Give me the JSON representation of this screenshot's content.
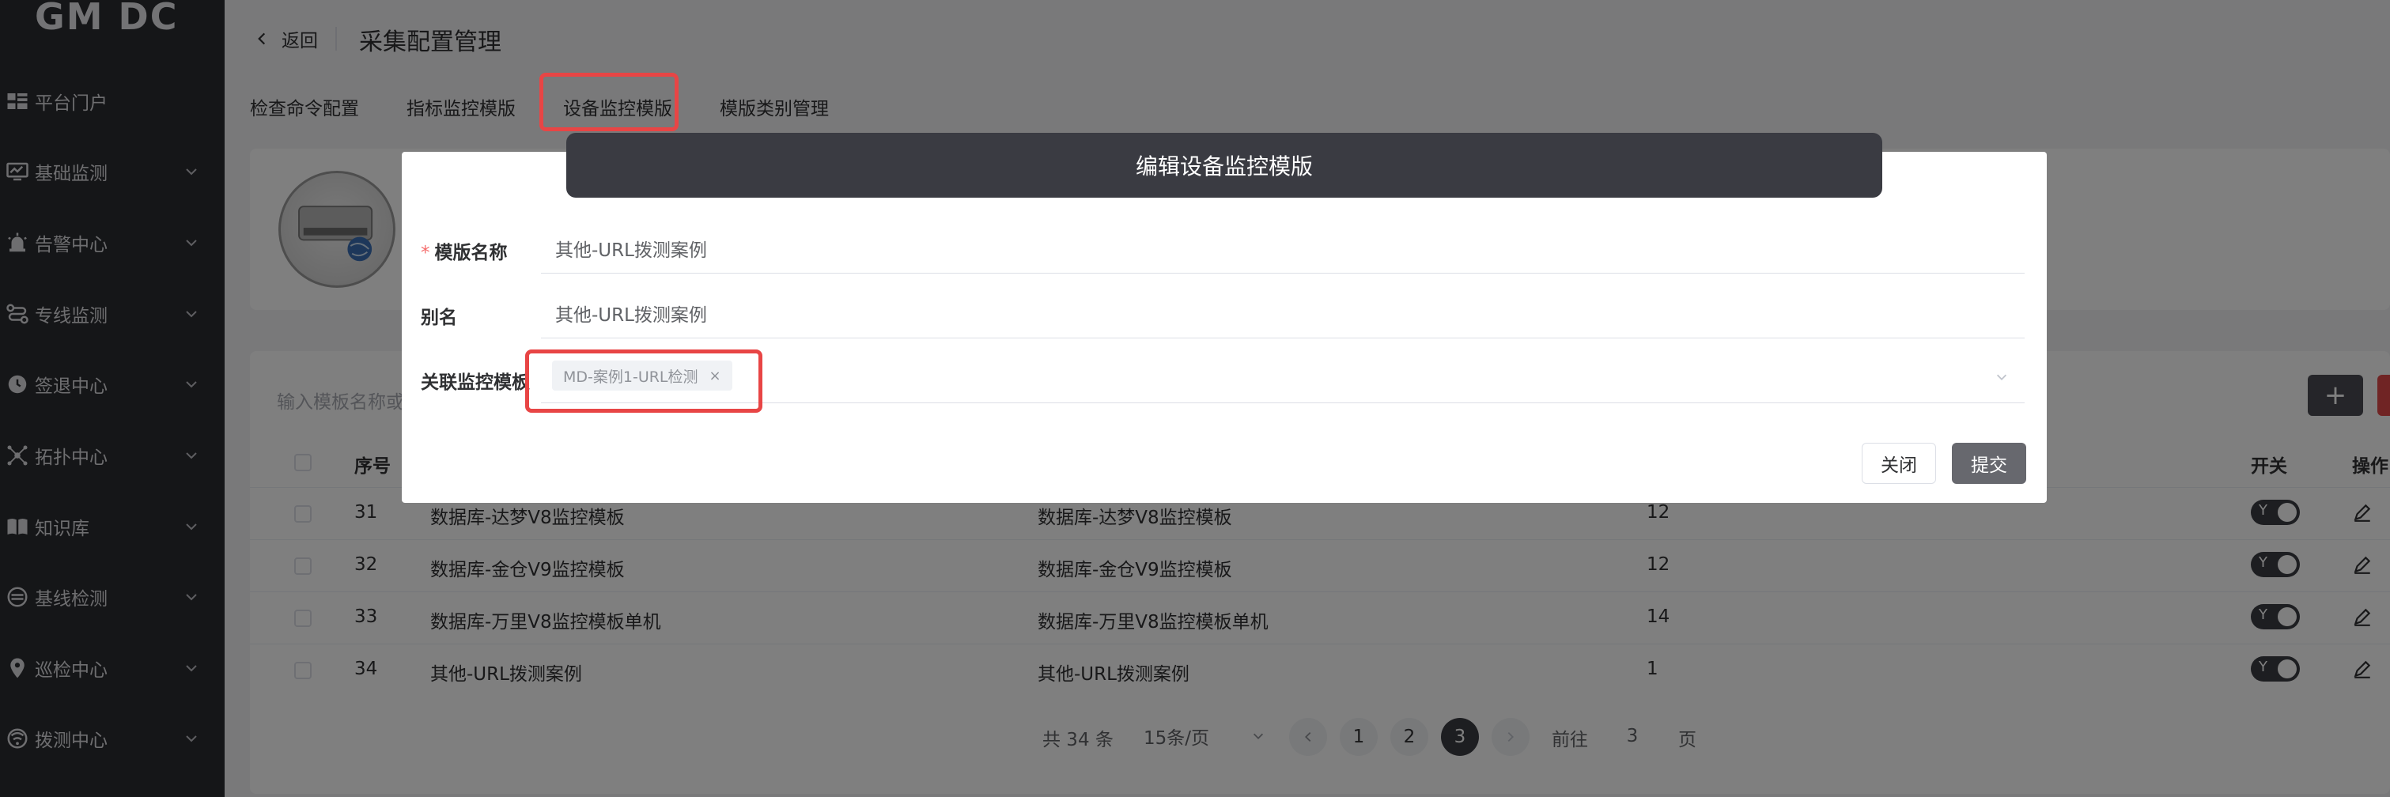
{
  "app": {
    "logo": "GM DC"
  },
  "sidebar": {
    "items": [
      {
        "label": "平台门户",
        "icon": "dashboard-icon",
        "has_children": false
      },
      {
        "label": "基础监测",
        "icon": "monitor-icon",
        "has_children": true
      },
      {
        "label": "告警中心",
        "icon": "alarm-icon",
        "has_children": true
      },
      {
        "label": "专线监测",
        "icon": "route-icon",
        "has_children": true
      },
      {
        "label": "签退中心",
        "icon": "clock-icon",
        "has_children": true
      },
      {
        "label": "拓扑中心",
        "icon": "topology-icon",
        "has_children": true
      },
      {
        "label": "知识库",
        "icon": "book-icon",
        "has_children": true
      },
      {
        "label": "基线检测",
        "icon": "baseline-icon",
        "has_children": true
      },
      {
        "label": "巡检中心",
        "icon": "location-icon",
        "has_children": true
      },
      {
        "label": "拨测中心",
        "icon": "probe-icon",
        "has_children": true
      }
    ]
  },
  "header": {
    "back_label": "返回",
    "title": "采集配置管理"
  },
  "tabs": [
    {
      "label": "检查命令配置",
      "active": false
    },
    {
      "label": "指标监控模版",
      "active": false
    },
    {
      "label": "设备监控模版",
      "active": true
    },
    {
      "label": "模版类别管理",
      "active": false
    }
  ],
  "list": {
    "search_placeholder": "输入模板名称或",
    "add_label": "+",
    "columns": [
      "序号",
      "开关",
      "操作"
    ],
    "rows": [
      {
        "no": "31",
        "name": "数据库-达梦V8监控模板",
        "alias": "数据库-达梦V8监控模板",
        "count": "12",
        "switch": "Y"
      },
      {
        "no": "32",
        "name": "数据库-金仓V9监控模板",
        "alias": "数据库-金仓V9监控模板",
        "count": "12",
        "switch": "Y"
      },
      {
        "no": "33",
        "name": "数据库-万里V8监控模板单机",
        "alias": "数据库-万里V8监控模板单机",
        "count": "14",
        "switch": "Y"
      },
      {
        "no": "34",
        "name": "其他-URL拨测案例",
        "alias": "其他-URL拨测案例",
        "count": "1",
        "switch": "Y"
      }
    ]
  },
  "pagination": {
    "total": "共 34 条",
    "page_size": "15条/页",
    "pages": [
      "1",
      "2",
      "3"
    ],
    "current": "3",
    "goto_label": "前往",
    "goto_value": "3",
    "unit": "页"
  },
  "dialog": {
    "title": "编辑设备监控模版",
    "fields": {
      "name_label": "模版名称",
      "name_value": "其他-URL拨测案例",
      "alias_label": "别名",
      "alias_value": "其他-URL拨测案例",
      "linked_label": "关联监控模板",
      "linked_tag": "MD-案例1-URL检测",
      "tag_remove": "×"
    },
    "close_label": "关闭",
    "submit_label": "提交"
  },
  "colors": {
    "accent": "#3b3c42",
    "highlight": "#e84545",
    "sidebar_bg": "#2b2c30"
  }
}
